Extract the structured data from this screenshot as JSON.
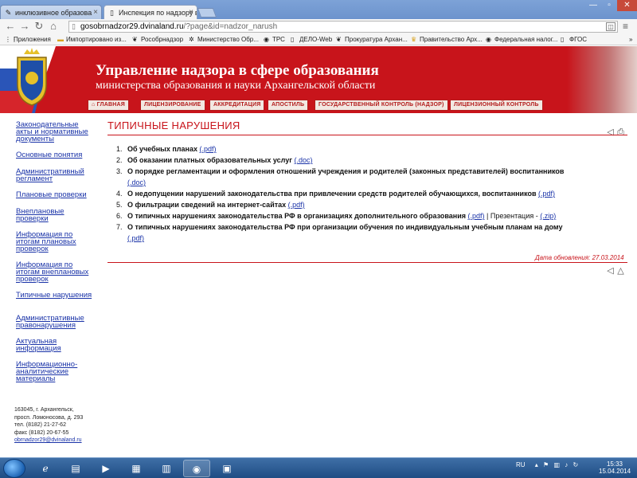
{
  "browser": {
    "tabs": [
      {
        "label": "инклюзивное образова",
        "active": false
      },
      {
        "label": "Инспекция по надзору в",
        "active": true
      }
    ],
    "url_host": "gosobrnadzor29.dvinaland.ru",
    "url_rest": "/?page&id=nadzor_narush",
    "bookmarks": [
      {
        "label": "Приложения",
        "icon": "apps-icon"
      },
      {
        "label": "Импортировано из...",
        "icon": "folder-icon"
      },
      {
        "label": "Рособрнадзор",
        "icon": "eagle-icon"
      },
      {
        "label": "Министерство Обр...",
        "icon": "gear-icon"
      },
      {
        "label": "ТРС",
        "icon": "globe-icon"
      },
      {
        "label": "ДЕЛО-Web",
        "icon": "page-icon"
      },
      {
        "label": "Прокуратура Архан...",
        "icon": "eagle-icon"
      },
      {
        "label": "Правительство Арх...",
        "icon": "crest-icon"
      },
      {
        "label": "Федеральная налог...",
        "icon": "globe-icon"
      },
      {
        "label": "ФГОС",
        "icon": "page-icon"
      }
    ],
    "overflow": "»"
  },
  "header": {
    "title": "Управление надзора в сфере образования",
    "subtitle": "министерства образования и науки Архангельской области",
    "nav": [
      {
        "label": "ГЛАВНАЯ",
        "icon": "home-icon"
      },
      {
        "label": "ЛИЦЕНЗИРОВАНИЕ"
      },
      {
        "label": "АККРЕДИТАЦИЯ"
      },
      {
        "label": "АПОСТИЛЬ"
      },
      {
        "label": "ГОСУДАРСТВЕННЫЙ КОНТРОЛЬ (НАДЗОР)"
      },
      {
        "label": "ЛИЦЕНЗИОННЫЙ КОНТРОЛЬ"
      }
    ]
  },
  "sidebar": {
    "links": [
      "Законодательные акты и нормативные документы",
      "Основные понятия",
      "Административный регламент",
      "Плановые проверки",
      "Внеплановые проверки",
      "Информация по итогам плановых проверок",
      "Информация по итогам внеплановых проверок",
      "Типичные нарушения",
      "Административные правонарушения",
      "Актуальная информация",
      "Информационно-аналитические материалы"
    ],
    "address": {
      "line1": "163045, г. Архангельск,",
      "line2": "просп. Ломоносова, д. 293",
      "phone": "тел. (8182) 21-27-62",
      "fax": "факс (8182) 20-67-55",
      "email": "obrnadzor29@dvinaland.ru"
    }
  },
  "main": {
    "title": "ТИПИЧНЫЕ НАРУШЕНИЯ",
    "items": [
      {
        "num": "1.",
        "text": "Об учебных планах",
        "link": "(.pdf)"
      },
      {
        "num": "2.",
        "text": "Об оказании платных образовательных услуг",
        "link": "(.doc)"
      },
      {
        "num": "3.",
        "text": "О порядке регламентации и оформления отношений учреждения и родителей (законных представителей) воспитанников",
        "link": "(.doc)"
      },
      {
        "num": "4.",
        "text": "О недопущении нарушений законодательства при привлечении средств родителей обучающихся, воспитанников",
        "link": "(.pdf)"
      },
      {
        "num": "5.",
        "text": "О фильтрации сведений на интернет-сайтах",
        "link": "(.pdf)"
      },
      {
        "num": "6.",
        "text": "О типичных нарушениях законодательства РФ в организациях дополнительного образования",
        "link": "(.pdf)",
        "extra_text": "| Презентация -",
        "extra_link": "(.zip)"
      },
      {
        "num": "7.",
        "text": "О типичных нарушениях законодательства РФ при организации обучения по индивидуальным учебным планам на дому",
        "link": "(.pdf)"
      }
    ],
    "updated": "Дата обновления: 27.03.2014"
  },
  "taskbar": {
    "lang": "RU",
    "time": "15:33",
    "date": "15.04.2014"
  },
  "colors": {
    "brand_red": "#c8141b",
    "link_blue": "#1a33a8"
  }
}
